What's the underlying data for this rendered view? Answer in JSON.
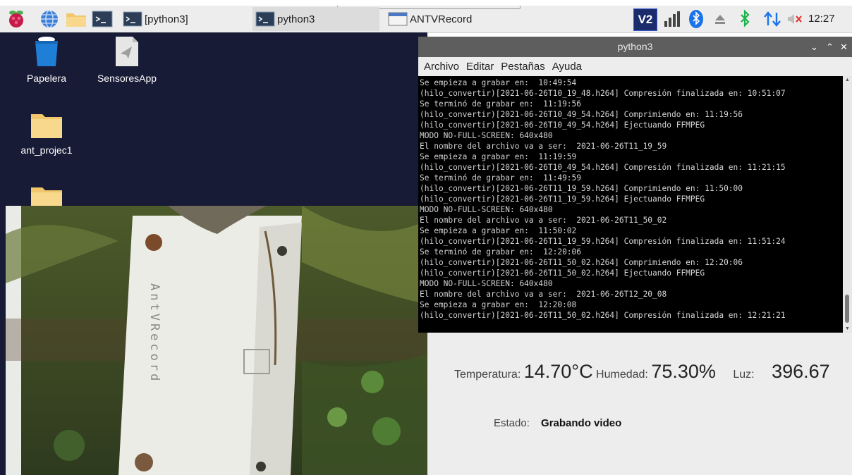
{
  "taskbar": {
    "tasks": [
      {
        "label": "[python3]"
      },
      {
        "label": "python3"
      },
      {
        "label": "ANTVRecord"
      }
    ],
    "tray": {
      "vnc_label": "V2"
    },
    "clock": "12:27"
  },
  "desktop": {
    "icons": [
      {
        "label": "Papelera"
      },
      {
        "label": "SensoresApp"
      },
      {
        "label": "ant_projec1"
      }
    ]
  },
  "camera": {
    "box_label": "AntVRecord"
  },
  "terminal": {
    "title": "python3",
    "menu": [
      "Archivo",
      "Editar",
      "Pestañas",
      "Ayuda"
    ],
    "lines": [
      "Se empieza a grabar en:  10:49:54",
      "(hilo_convertir)[2021-06-26T10_19_48.h264] Compresión finalizada en: 10:51:07",
      "Se terminó de grabar en:  11:19:56",
      "(hilo_convertir)[2021-06-26T10_49_54.h264] Comprimiendo en: 11:19:56",
      "(hilo_convertir)[2021-06-26T10_49_54.h264] Ejectuando FFMPEG",
      "MODO NO-FULL-SCREEN: 640x480",
      "El nombre del archivo va a ser:  2021-06-26T11_19_59",
      "Se empieza a grabar en:  11:19:59",
      "(hilo_convertir)[2021-06-26T10_49_54.h264] Compresión finalizada en: 11:21:15",
      "Se terminó de grabar en:  11:49:59",
      "(hilo_convertir)[2021-06-26T11_19_59.h264] Comprimiendo en: 11:50:00",
      "(hilo_convertir)[2021-06-26T11_19_59.h264] Ejectuando FFMPEG",
      "MODO NO-FULL-SCREEN: 640x480",
      "El nombre del archivo va a ser:  2021-06-26T11_50_02",
      "Se empieza a grabar en:  11:50:02",
      "(hilo_convertir)[2021-06-26T11_19_59.h264] Compresión finalizada en: 11:51:24",
      "Se terminó de grabar en:  12:20:06",
      "(hilo_convertir)[2021-06-26T11_50_02.h264] Comprimiendo en: 12:20:06",
      "(hilo_convertir)[2021-06-26T11_50_02.h264] Ejectuando FFMPEG",
      "MODO NO-FULL-SCREEN: 640x480",
      "El nombre del archivo va a ser:  2021-06-26T12_20_08",
      "Se empieza a grabar en:  12:20:08",
      "(hilo_convertir)[2021-06-26T11_50_02.h264] Compresión finalizada en: 12:21:21"
    ]
  },
  "sensors": {
    "temperature_label": "Temperatura:",
    "temperature_value": "14.70°C",
    "humidity_label": "Humedad:",
    "humidity_value": "75.30%",
    "light_label": "Luz:",
    "light_value": "396.67",
    "status_label": "Estado:",
    "status_value": "Grabando video"
  },
  "colors": {
    "desktop_bg": "#181b36",
    "taskbar_bg": "#ededed",
    "terminal_bg": "#000000",
    "titlebar_bg": "#5e5e5e",
    "accent_bluetooth": "#1a73e8",
    "accent_green": "#19b34a"
  },
  "icons": [
    "raspberry-pi-icon",
    "globe-icon",
    "folder-icon",
    "terminal-icon",
    "vnc-icon",
    "signal-icon",
    "bluetooth-icon",
    "eject-icon",
    "bluetooth-green-icon",
    "network-arrows-icon",
    "volume-muted-icon",
    "trash-icon",
    "app-icon"
  ]
}
